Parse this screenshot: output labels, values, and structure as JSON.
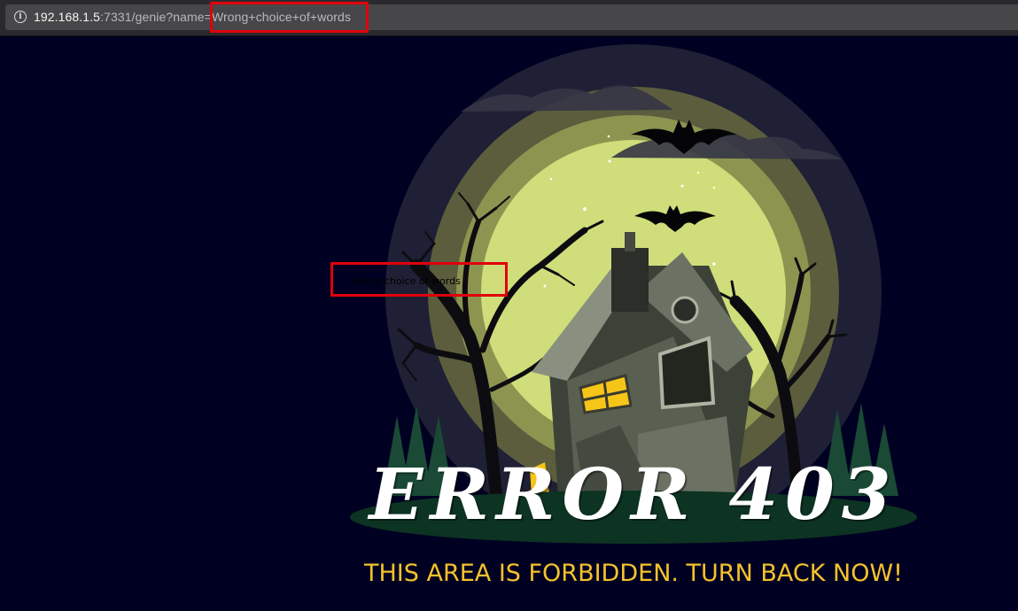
{
  "browser": {
    "url_host": "192.168.1.5",
    "url_rest": ":7331/genie?name=",
    "url_query": "Wrong+choice+of+words",
    "info_icon": "info-icon"
  },
  "page": {
    "reflected_text": "Wrong choice of words",
    "error_title": "ERROR 403",
    "subtitle": "THIS AREA IS FORBIDDEN. TURN BACK NOW!"
  },
  "colors": {
    "background": "#000022",
    "moon": "#cfdd7a",
    "subtitle": "#f5c22b",
    "highlight": "#e0000b"
  }
}
